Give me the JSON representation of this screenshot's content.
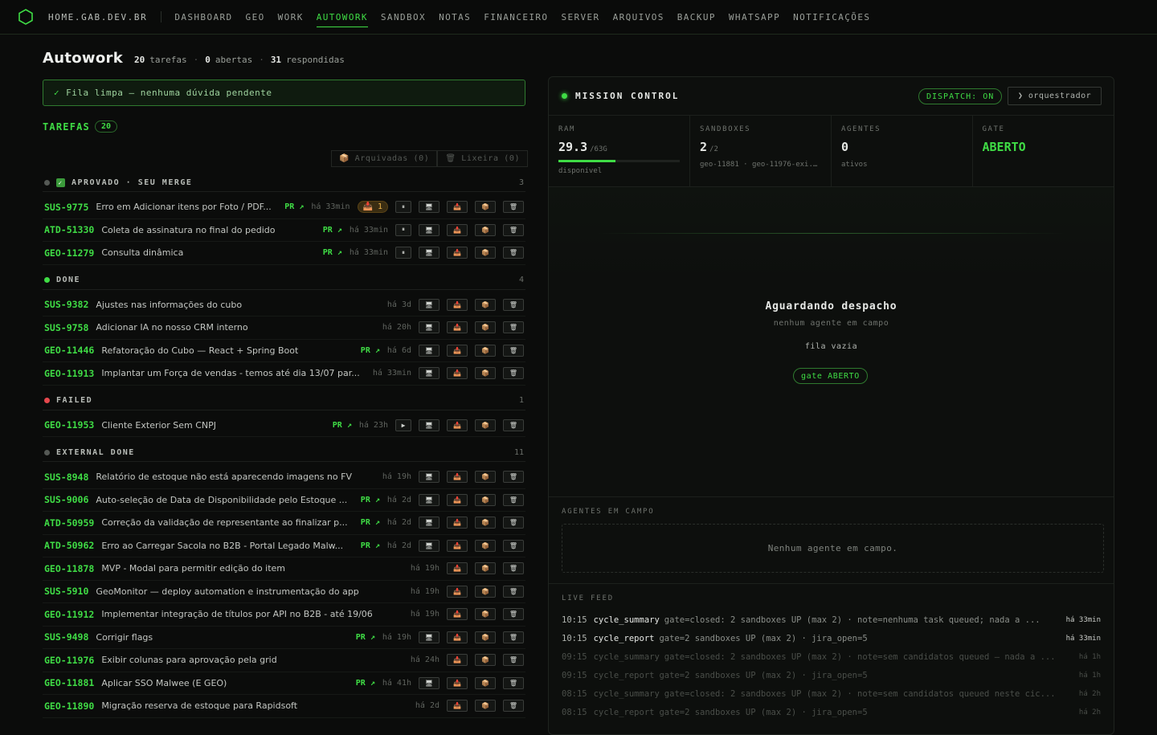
{
  "nav": {
    "brand": "HOME.GAB.DEV.BR",
    "links": [
      "DASHBOARD",
      "GEO",
      "WORK",
      "AUTOWORK",
      "SANDBOX",
      "NOTAS",
      "FINANCEIRO",
      "SERVER",
      "ARQUIVOS",
      "BACKUP",
      "WHATSAPP",
      "NOTIFICAÇÕES"
    ],
    "active": "AUTOWORK"
  },
  "header": {
    "title": "Autowork",
    "tarefas_n": "20",
    "tarefas_l": "tarefas",
    "abertas_n": "0",
    "abertas_l": "abertas",
    "resp_n": "31",
    "resp_l": "respondidas",
    "dot": "·"
  },
  "banner": {
    "check": "✓",
    "text": "Fila limpa — nenhuma dúvida pendente"
  },
  "tasks": {
    "label": "TAREFAS",
    "count": "20",
    "archived": "📦 Arquivadas (0)",
    "trash": "🗑 Lixeira (0)",
    "groups": [
      {
        "name": "APROVADO · SEU MERGE",
        "count": "3",
        "dot": "#555955",
        "emoji": true,
        "rows": [
          {
            "id": "SUS-9775",
            "title": "Erro em Adicionar itens por Foto / PDF...",
            "pr": "PR ↗",
            "age": "há 33min",
            "badge": "📥 1",
            "buttons": [
              "⏸",
              "🖥",
              "📥",
              "📦",
              "🗑"
            ]
          },
          {
            "id": "ATD-51330",
            "title": "Coleta de assinatura no final do pedido",
            "pr": "PR ↗",
            "age": "há 33min",
            "buttons": [
              "⏸",
              "🖥",
              "📥",
              "📦",
              "🗑"
            ]
          },
          {
            "id": "GEO-11279",
            "title": "Consulta dinâmica",
            "pr": "PR ↗",
            "age": "há 33min",
            "buttons": [
              "⏸",
              "🖥",
              "📥",
              "📦",
              "🗑"
            ]
          }
        ]
      },
      {
        "name": "DONE",
        "count": "4",
        "dot": "#3fdc45",
        "rows": [
          {
            "id": "SUS-9382",
            "title": "Ajustes nas informações do cubo",
            "age": "há 3d",
            "buttons": [
              "🖥",
              "📥",
              "📦",
              "🗑"
            ]
          },
          {
            "id": "SUS-9758",
            "title": "Adicionar IA no nosso CRM interno",
            "age": "há 20h",
            "buttons": [
              "🖥",
              "📥",
              "📦",
              "🗑"
            ]
          },
          {
            "id": "GEO-11446",
            "title": "Refatoração do Cubo — React + Spring Boot",
            "pr": "PR ↗",
            "age": "há 6d",
            "buttons": [
              "🖥",
              "📥",
              "📦",
              "🗑"
            ]
          },
          {
            "id": "GEO-11913",
            "title": "Implantar um Força de vendas - temos até dia 13/07 par...",
            "age": "há 33min",
            "buttons": [
              "🖥",
              "📥",
              "📦",
              "🗑"
            ]
          }
        ]
      },
      {
        "name": "FAILED",
        "count": "1",
        "dot": "#e5484d",
        "rows": [
          {
            "id": "GEO-11953",
            "title": "Cliente Exterior Sem CNPJ",
            "pr": "PR ↗",
            "age": "há 23h",
            "buttons": [
              "▶",
              "🖥",
              "📥",
              "📦",
              "🗑"
            ]
          }
        ]
      },
      {
        "name": "EXTERNAL DONE",
        "count": "11",
        "dot": "#555955",
        "rows": [
          {
            "id": "SUS-8948",
            "title": "Relatório de estoque não está aparecendo imagens no FV",
            "age": "há 19h",
            "buttons": [
              "🖥",
              "📥",
              "📦",
              "🗑"
            ]
          },
          {
            "id": "SUS-9006",
            "title": "Auto-seleção de Data de Disponibilidade pelo Estoque ...",
            "pr": "PR ↗",
            "age": "há 2d",
            "buttons": [
              "🖥",
              "📥",
              "📦",
              "🗑"
            ]
          },
          {
            "id": "ATD-50959",
            "title": "Correção da validação de representante ao finalizar p...",
            "pr": "PR ↗",
            "age": "há 2d",
            "buttons": [
              "🖥",
              "📥",
              "📦",
              "🗑"
            ]
          },
          {
            "id": "ATD-50962",
            "title": "Erro ao Carregar Sacola no B2B - Portal Legado Malw...",
            "pr": "PR ↗",
            "age": "há 2d",
            "buttons": [
              "🖥",
              "📥",
              "📦",
              "🗑"
            ]
          },
          {
            "id": "GEO-11878",
            "title": "MVP - Modal para permitir edição do item",
            "age": "há 19h",
            "buttons": [
              "📥",
              "📦",
              "🗑"
            ]
          },
          {
            "id": "SUS-5910",
            "title": "GeoMonitor — deploy automation e instrumentação do app",
            "age": "há 19h",
            "buttons": [
              "📥",
              "📦",
              "🗑"
            ]
          },
          {
            "id": "GEO-11912",
            "title": "Implementar integração de títulos por API no B2B - até 19/06",
            "age": "há 19h",
            "buttons": [
              "📥",
              "📦",
              "🗑"
            ]
          },
          {
            "id": "SUS-9498",
            "title": "Corrigir flags",
            "pr": "PR ↗",
            "age": "há 19h",
            "buttons": [
              "🖥",
              "📥",
              "📦",
              "🗑"
            ]
          },
          {
            "id": "GEO-11976",
            "title": "Exibir colunas para aprovação pela grid",
            "age": "há 24h",
            "buttons": [
              "📥",
              "📦",
              "🗑"
            ]
          },
          {
            "id": "GEO-11881",
            "title": "Aplicar SSO Malwee (E GEO)",
            "pr": "PR ↗",
            "age": "há 41h",
            "buttons": [
              "🖥",
              "📥",
              "📦",
              "🗑"
            ]
          },
          {
            "id": "GEO-11890",
            "title": "Migração reserva de estoque para Rapidsoft",
            "age": "há 2d",
            "buttons": [
              "📥",
              "📦",
              "🗑"
            ]
          }
        ]
      }
    ]
  },
  "mission": {
    "title": "MISSION CONTROL",
    "dispatch": "DISPATCH: ON",
    "orquestrador": "❯ orquestrador",
    "ram": {
      "label": "RAM",
      "value": "29.3",
      "unit": "/63G",
      "sub": "disponível",
      "fraction": 0.47
    },
    "sandboxes": {
      "label": "SANDBOXES",
      "value": "2",
      "unit": "/2",
      "sub": "geo-11881 · geo-11976-exi..."
    },
    "agentes": {
      "label": "AGENTES",
      "value": "0",
      "sub": "ativos"
    },
    "gate": {
      "label": "GATE",
      "value": "ABERTO"
    },
    "waiting": "Aguardando despacho",
    "waiting_sub": "nenhum agente em campo",
    "queue": "fila vazia",
    "gate_pill": "gate ABERTO",
    "agents_label": "AGENTES EM CAMPO",
    "agents_empty": "Nenhum agente em campo.",
    "feed_label": "LIVE FEED",
    "feed": [
      {
        "t": "10:15",
        "k": "cycle_summary",
        "m": "gate=closed: 2 sandboxes UP (max 2) · note=nenhuma task queued; nada a ...",
        "a": "há 33min",
        "dim": false
      },
      {
        "t": "10:15",
        "k": "cycle_report",
        "m": "gate=2 sandboxes UP (max 2) · jira_open=5",
        "a": "há 33min",
        "dim": false
      },
      {
        "t": "09:15",
        "k": "cycle_summary",
        "m": "gate=closed: 2 sandboxes UP (max 2) · note=sem candidatos queued — nada a ...",
        "a": "há 1h",
        "dim": true
      },
      {
        "t": "09:15",
        "k": "cycle_report",
        "m": "gate=2 sandboxes UP (max 2) · jira_open=5",
        "a": "há 1h",
        "dim": true
      },
      {
        "t": "08:15",
        "k": "cycle_summary",
        "m": "gate=closed: 2 sandboxes UP (max 2) · note=sem candidatos queued neste cic...",
        "a": "há 2h",
        "dim": true
      },
      {
        "t": "08:15",
        "k": "cycle_report",
        "m": "gate=2 sandboxes UP (max 2) · jira_open=5",
        "a": "há 2h",
        "dim": true
      }
    ]
  }
}
